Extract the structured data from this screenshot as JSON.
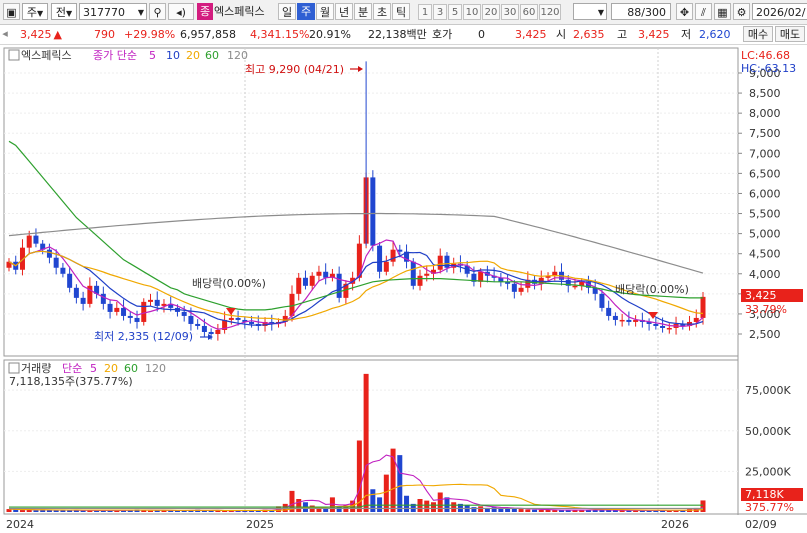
{
  "toolbar": {
    "market": "주",
    "jeon": "전",
    "code": "317770",
    "name_badge": "종",
    "name": "엑스페릭스",
    "periods": [
      "일",
      "주",
      "월",
      "년",
      "분",
      "초",
      "틱"
    ],
    "active_period": "주",
    "numbers": [
      "1",
      "3",
      "5",
      "10",
      "20",
      "30",
      "60",
      "120"
    ],
    "count": "88/300",
    "date": "2026/02/"
  },
  "quote": {
    "price": "3,425",
    "arrow": "▲",
    "change": "790",
    "change_pct": "+29.98%",
    "volume": "6,957,858",
    "vol_pct": "4,341.15%",
    "turnover": "20.91%",
    "amount": "22,138백만",
    "hoga_label": "호가",
    "hoga_value": "0",
    "price2": "3,425",
    "open_label": "시",
    "open": "2,635",
    "high_label": "고",
    "high": "3,425",
    "low_label": "저",
    "low": "2,620",
    "buy": "매수",
    "sell": "매도"
  },
  "price_panel": {
    "legend_name": "엑스페릭스",
    "legend_ma_label": "종가 단순",
    "ma_periods": [
      "5",
      "10",
      "20",
      "60",
      "120"
    ],
    "lc": "LC:46.68",
    "hc": "HC:-63.13",
    "max_annot": "최고 9,290 (04/21)",
    "min_annot": "최저 2,335 (12/09)",
    "div1": "배당락(0.00%)",
    "div2": "배당락(0.00%)",
    "price_tag": "3,425",
    "pct_tag": "33.79%",
    "y_ticks": [
      "9,000",
      "8,500",
      "8,000",
      "7,500",
      "7,000",
      "6,500",
      "6,000",
      "5,500",
      "5,000",
      "4,500",
      "4,000",
      "3,500",
      "3,000",
      "2,500"
    ]
  },
  "volume_panel": {
    "label": "거래량",
    "ma_label": "단순",
    "ma_periods": [
      "5",
      "20",
      "60",
      "120"
    ],
    "current": "7,118,135주(375.77%)",
    "tag": "7,118K",
    "pct_tag": "375.77%",
    "y_ticks": [
      "75,000K",
      "50,000K",
      "25,000K"
    ]
  },
  "x_axis": {
    "labels": [
      "2024",
      "2025",
      "2026",
      "02/09"
    ]
  },
  "colors": {
    "up": "#e8221b",
    "down": "#2046d0",
    "ma5": "#c020c0",
    "ma10": "#1f3fc8",
    "ma20": "#f0a800",
    "ma60": "#2ea02e",
    "ma120": "#8c8c8c"
  }
}
